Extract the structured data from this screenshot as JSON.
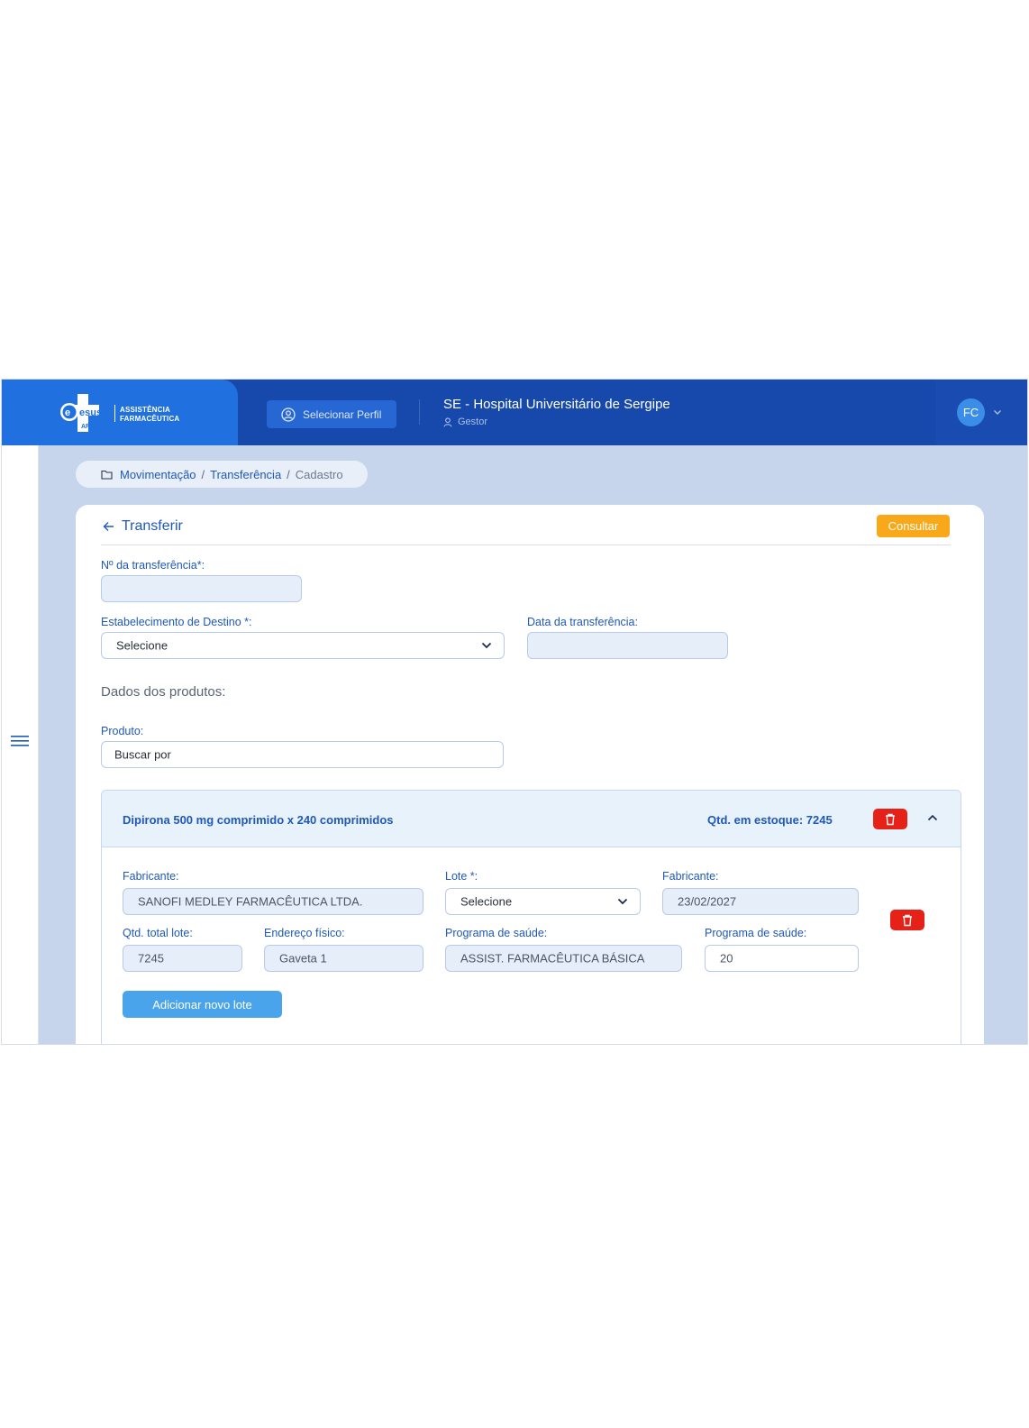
{
  "header": {
    "logo_brand": "esus",
    "logo_sub": "AF",
    "logo_text_line1": "ASSISTÊNCIA",
    "logo_text_line2": "FARMACÊUTICA",
    "select_profile_label": "Selecionar Perfil",
    "hospital_name": "SE - Hospital Universitário de Sergipe",
    "role": "Gestor",
    "user_initials": "FC"
  },
  "breadcrumb": {
    "part1": "Movimentação",
    "part2": "Transferência",
    "current": "Cadastro",
    "separator": "/"
  },
  "form": {
    "title": "Transferir",
    "consult_label": "Consultar",
    "transfer_number_label": "Nº da transferência*:",
    "transfer_number_value": "",
    "destination_label": "Estabelecimento de Destino *:",
    "destination_value": "Selecione",
    "date_label": "Data da transferência:",
    "date_value": "",
    "products_section_title": "Dados dos produtos:",
    "product_label": "Produto:",
    "product_placeholder": "Buscar por"
  },
  "product": {
    "name": "Dipirona 500 mg comprimido x 240 comprimidos",
    "stock_label": "Qtd. em estoque: 7245",
    "lot": {
      "manufacturer_label": "Fabricante:",
      "manufacturer_value": "SANOFI MEDLEY FARMACÊUTICA LTDA.",
      "lot_label": "Lote *:",
      "lot_value": "Selecione",
      "expiry_label": "Fabricante:",
      "expiry_value": "23/02/2027",
      "total_qty_label": "Qtd. total lote:",
      "total_qty_value": "7245",
      "address_label": "Endereço físico:",
      "address_value": "Gaveta 1",
      "program_label": "Programa de saúde:",
      "program_value": "ASSIST. FARMACÊUTICA BÁSICA",
      "quantity_label": "Programa de saúde:",
      "quantity_value": "20"
    },
    "add_lot_label": "Adicionar novo lote"
  },
  "colors": {
    "header_bg": "#1749ad",
    "brand_bg": "#2070e0",
    "accent_blue": "#1f58b8",
    "consult_orange": "#f9a81a",
    "delete_red": "#e62117",
    "add_button": "#4aa4ec",
    "page_bg": "#c6d5ec"
  },
  "icons": [
    "user-circle-icon",
    "user-icon",
    "chevron-down-icon",
    "menu-icon",
    "folder-icon",
    "arrow-left-icon",
    "trash-icon",
    "chevron-up-icon"
  ]
}
